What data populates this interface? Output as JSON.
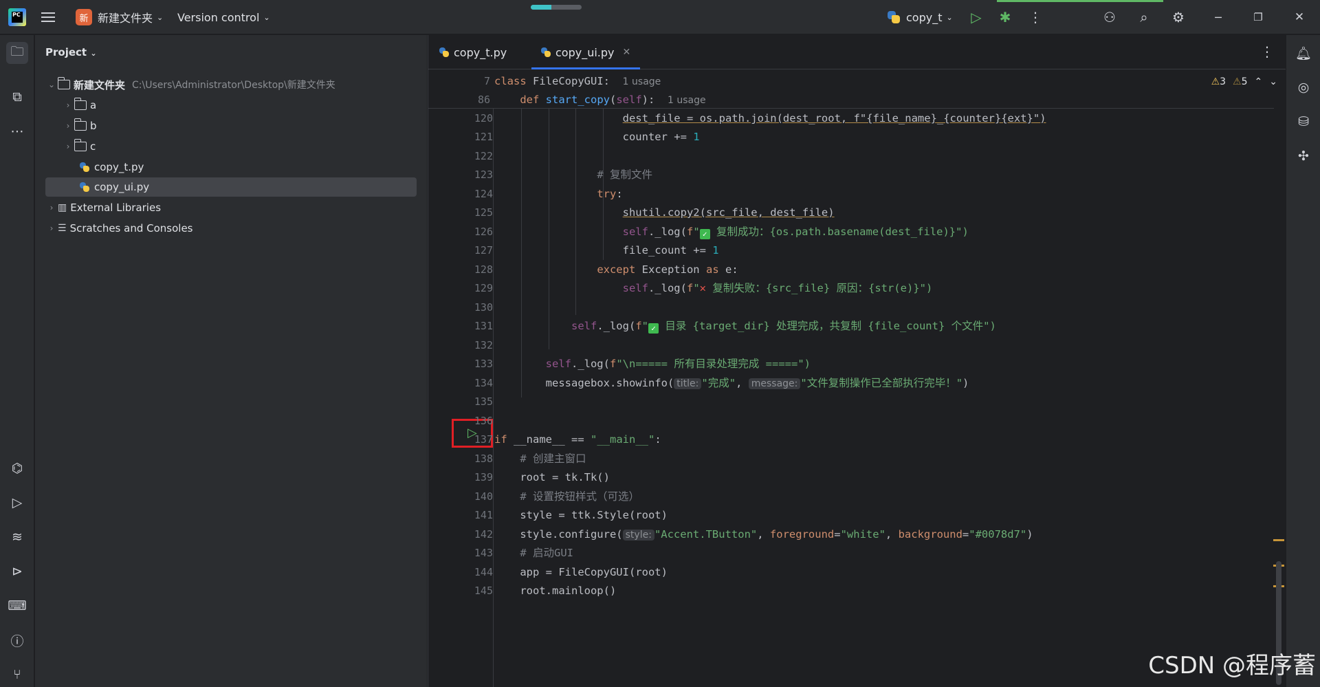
{
  "titlebar": {
    "project_badge": "新",
    "project_name": "新建文件夹",
    "vcs_label": "Version control",
    "run_config": "copy_t"
  },
  "project_panel": {
    "header": "Project",
    "root_name": "新建文件夹",
    "root_path": "C:\\Users\\Administrator\\Desktop\\新建文件夹",
    "items": [
      {
        "label": "a"
      },
      {
        "label": "b"
      },
      {
        "label": "c"
      },
      {
        "label": "copy_t.py"
      },
      {
        "label": "copy_ui.py"
      },
      {
        "label": "External Libraries"
      },
      {
        "label": "Scratches and Consoles"
      }
    ]
  },
  "tabs": [
    {
      "label": "copy_t.py"
    },
    {
      "label": "copy_ui.py"
    }
  ],
  "inspections": {
    "warnings": "3",
    "weak_warnings": "5"
  },
  "sticky": {
    "line1_no": "7",
    "line1_kw": "class",
    "line1_name": "FileCopyGUI",
    "line1_hint": "1 usage",
    "line2_no": "86",
    "line2_kw": "def",
    "line2_name": "start_copy",
    "line2_self": "self",
    "line2_hint": "1 usage"
  },
  "line_numbers": [
    "120",
    "121",
    "122",
    "123",
    "124",
    "125",
    "126",
    "127",
    "128",
    "129",
    "130",
    "131",
    "132",
    "133",
    "134",
    "135",
    "136",
    "137",
    "138",
    "139",
    "140",
    "141",
    "142",
    "143",
    "144",
    "145"
  ],
  "code": {
    "l120": "dest_file = os.path.join(dest_root, f\"{file_name}_{counter}{ext}\")",
    "l121_a": "counter += ",
    "l121_b": "1",
    "l123": "# 复制文件",
    "l124": "try",
    "l125": "shutil.copy2(src_file, dest_file)",
    "l126_msg": " 复制成功：{os.path.basename(dest_file)}\")",
    "l127_a": "file_count += ",
    "l127_b": "1",
    "l128_kw1": "except",
    "l128_exc": "Exception",
    "l128_kw2": "as",
    "l128_var": "e:",
    "l129_msg": " 复制失败：{src_file} 原因：{str(e)}\")",
    "l131_msg": " 目录 {target_dir} 处理完成，共复制 {file_count} 个文件\")",
    "l133_msg": "\\n===== 所有目录处理完成 =====\")",
    "l134_call": "messagebox.showinfo(",
    "l134_p1": "title:",
    "l134_s1": "\"完成\"",
    "l134_p2": "message:",
    "l134_s2": "\"文件复制操作已全部执行完毕！\"",
    "l137_kw": "if",
    "l137_rest": " __name__ == ",
    "l137_str": "\"__main__\"",
    "l138": "# 创建主窗口",
    "l139": "root = tk.Tk()",
    "l140": "# 设置按钮样式（可选）",
    "l141": "style = ttk.Style(root)",
    "l142_call": "style.configure(",
    "l142_p": "style:",
    "l142_s1": "\"Accent.TButton\"",
    "l142_k1": "foreground",
    "l142_s2": "\"white\"",
    "l142_k2": "background",
    "l142_s3": "\"#0078d7\"",
    "l143": "# 启动GUI",
    "l144": "app = FileCopyGUI(root)",
    "l145": "root.mainloop()"
  },
  "watermark": "CSDN @程序蓄"
}
